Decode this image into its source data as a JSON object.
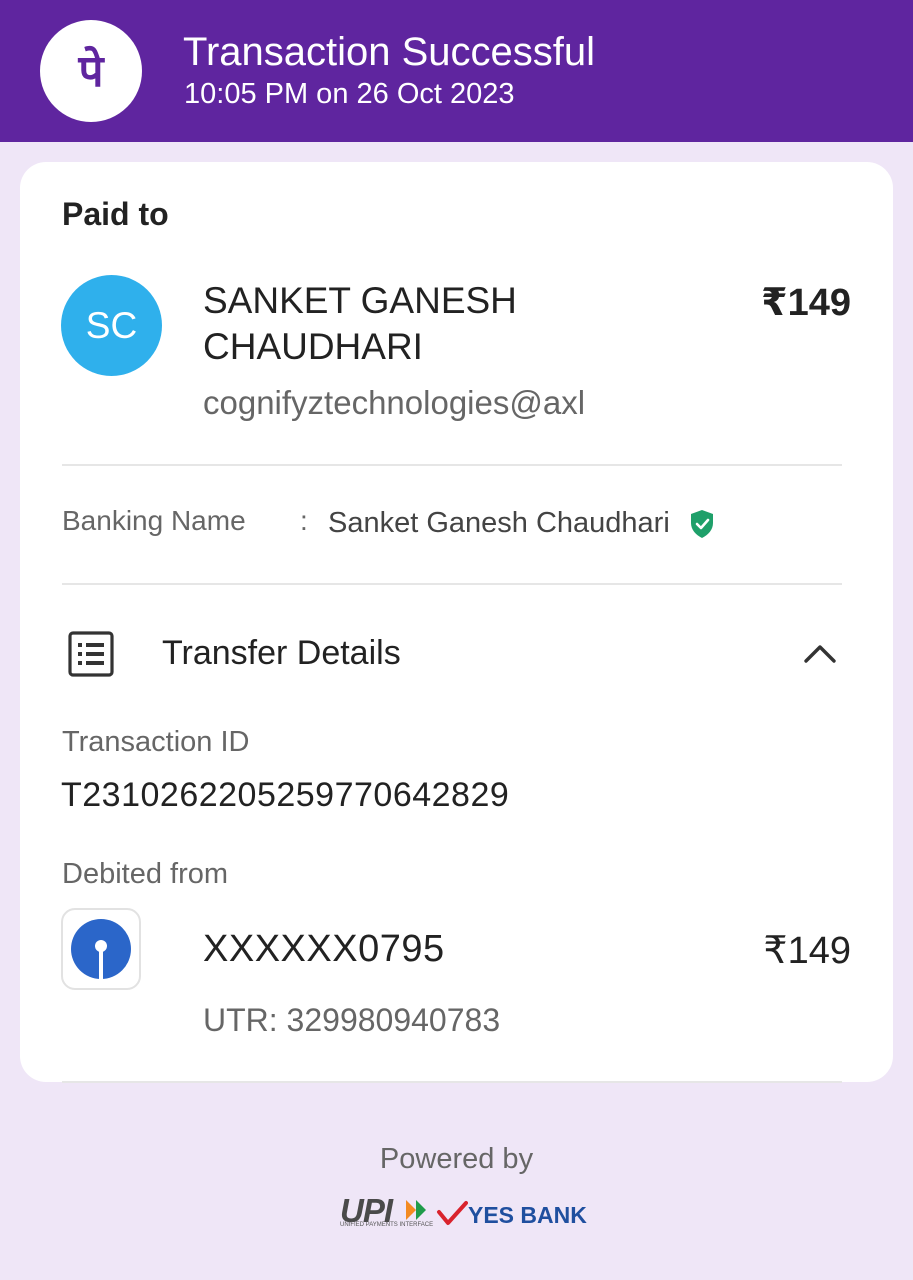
{
  "header": {
    "title": "Transaction Successful",
    "datetime": "10:05 PM on 26 Oct 2023",
    "logo_glyph": "पे",
    "bg_color": "#5f259f"
  },
  "paid_to": {
    "label": "Paid to",
    "initials": "SC",
    "name": "SANKET GANESH CHAUDHARI",
    "upi_id": "cognifyztechnologies@axl",
    "amount": "₹149",
    "avatar_color": "#2fb0ec"
  },
  "banking": {
    "label": "Banking Name",
    "separator": ":",
    "value": "Sanket Ganesh Chaudhari",
    "verified_icon": "verified-shield-icon"
  },
  "transfer": {
    "title": "Transfer Details",
    "icon": "list-icon",
    "toggle_icon": "chevron-up-icon",
    "transaction_id_label": "Transaction ID",
    "transaction_id": "T2310262205259770642829",
    "debited_label": "Debited from",
    "account": "XXXXXX0795",
    "amount": "₹149",
    "utr": "UTR: 329980940783",
    "bank_icon": "sbi-logo-icon"
  },
  "footer": {
    "powered_by": "Powered by",
    "upi_label": "UPI",
    "upi_sub": "UNIFIED PAYMENTS INTERFACE",
    "bank": "YES BANK"
  }
}
